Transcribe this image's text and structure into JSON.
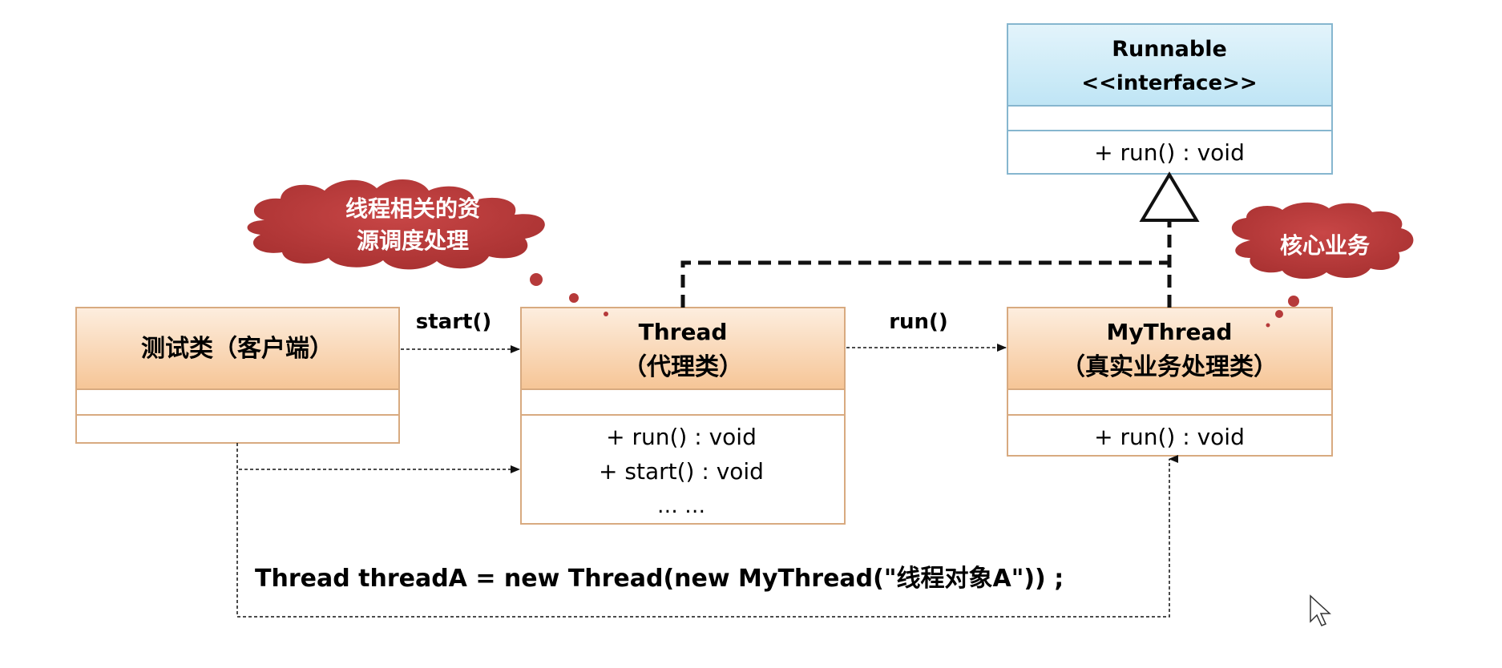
{
  "colors": {
    "interface_header": "#bfe6f6",
    "interface_border": "#7fb2cc",
    "class_header_top": "#fdecdc",
    "class_header_bottom": "#f7c89c",
    "class_border": "#d4a176",
    "cloud_fill": "#bf4040",
    "cloud_text": "#ffffff",
    "arrow": "#111111"
  },
  "runnable": {
    "name": "Runnable",
    "stereotype": "<<interface>>",
    "method": "+ run() : void"
  },
  "client": {
    "name": "测试类（客户端）"
  },
  "thread": {
    "name": "Thread",
    "subtitle": "（代理类）",
    "methods": [
      "+ run() : void",
      "+ start() : void",
      "… …"
    ]
  },
  "mythread": {
    "name": "MyThread",
    "subtitle": "（真实业务处理类）",
    "method": "+ run() : void"
  },
  "arrows": {
    "start_label": "start()",
    "run_label": "run()"
  },
  "clouds": {
    "thread_note_line1": "线程相关的资",
    "thread_note_line2": "源调度处理",
    "mythread_note": "核心业务"
  },
  "code_line": "Thread threadA = new Thread(new MyThread(\"线程对象A\")) ;"
}
